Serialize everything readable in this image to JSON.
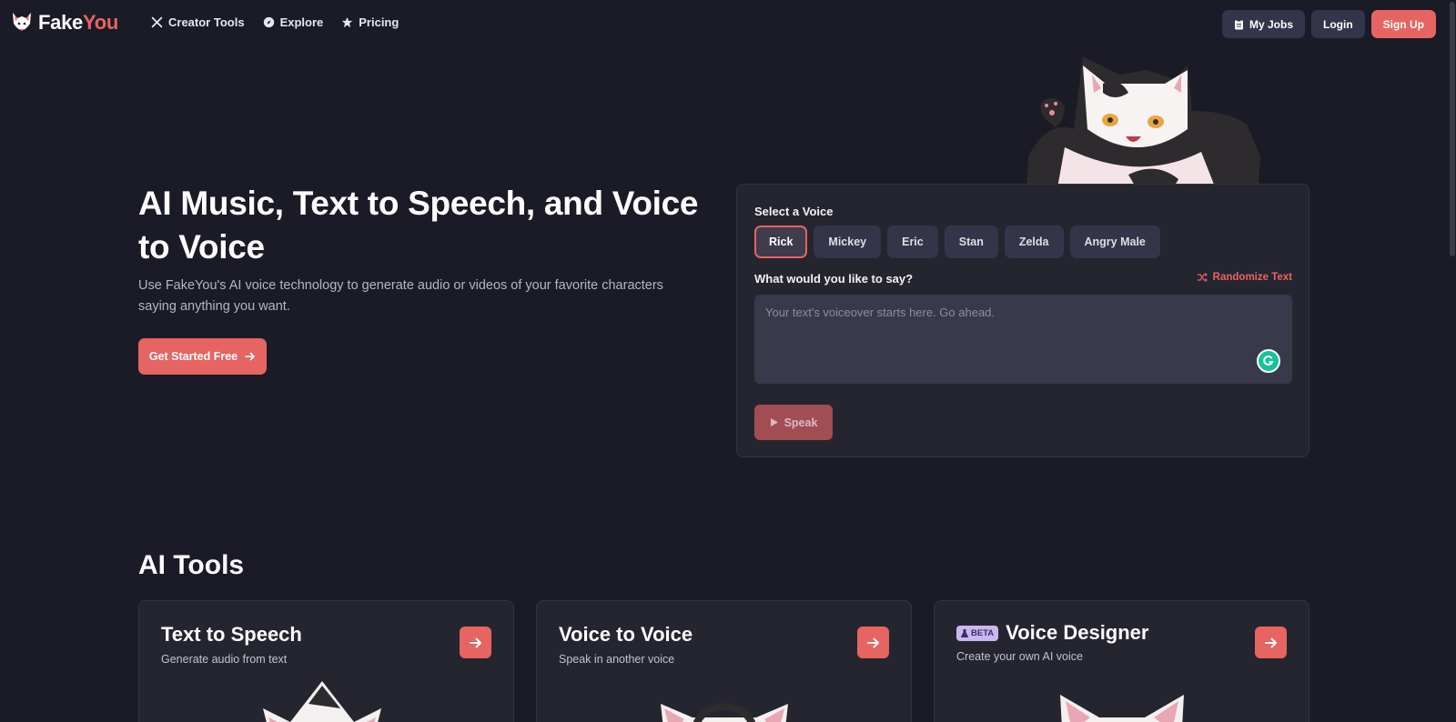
{
  "nav": {
    "logo": {
      "part1": "Fake",
      "part2": "You"
    },
    "links": [
      {
        "label": "Creator Tools",
        "icon": "tools-icon"
      },
      {
        "label": "Explore",
        "icon": "compass-icon"
      },
      {
        "label": "Pricing",
        "icon": "star-icon"
      }
    ],
    "my_jobs": "My Jobs",
    "login": "Login",
    "signup": "Sign Up"
  },
  "hero": {
    "title": "AI Music, Text to Speech, and Voice to Voice",
    "subtitle": "Use FakeYou's AI voice technology to generate audio or videos of your favorite characters saying anything you want.",
    "cta": "Get Started Free"
  },
  "tts": {
    "select_label": "Select a Voice",
    "voices": [
      "Rick",
      "Mickey",
      "Eric",
      "Stan",
      "Zelda",
      "Angry Male"
    ],
    "selected_voice": "Rick",
    "prompt_label": "What would you like to say?",
    "randomize": "Randomize Text",
    "placeholder": "Your text's voiceover starts here. Go ahead.",
    "speak": "Speak"
  },
  "tools": {
    "title": "AI Tools",
    "cards": [
      {
        "title": "Text to Speech",
        "subtitle": "Generate audio from text"
      },
      {
        "title": "Voice to Voice",
        "subtitle": "Speak in another voice"
      },
      {
        "title": "Voice Designer",
        "subtitle": "Create your own AI voice",
        "badge": "BETA"
      }
    ]
  },
  "colors": {
    "accent": "#e66462",
    "background": "#1b1b27",
    "card": "#25252f",
    "button_dark": "#34354a"
  }
}
